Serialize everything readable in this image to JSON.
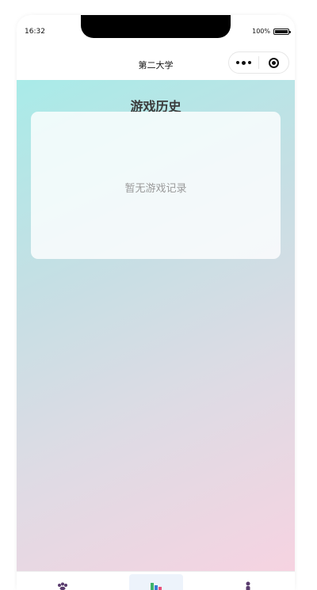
{
  "status_bar": {
    "time": "16:32",
    "battery": "100%"
  },
  "nav": {
    "title": "第二大学"
  },
  "page": {
    "heading": "游戏历史",
    "empty_message": "暂无游戏记录"
  },
  "tabs": [
    {
      "icon": "paw-icon",
      "active": false,
      "color": "#5a3c6e"
    },
    {
      "icon": "bar-chart-icon",
      "active": true,
      "color": "#3a7bd5"
    },
    {
      "icon": "user-icon",
      "active": false,
      "color": "#5a3c6e"
    }
  ],
  "colors": {
    "gradient_start": "#a9ebe8",
    "gradient_end": "#f6d3e1",
    "heading": "#3b3b3b",
    "empty_text": "#9a9a9a"
  }
}
